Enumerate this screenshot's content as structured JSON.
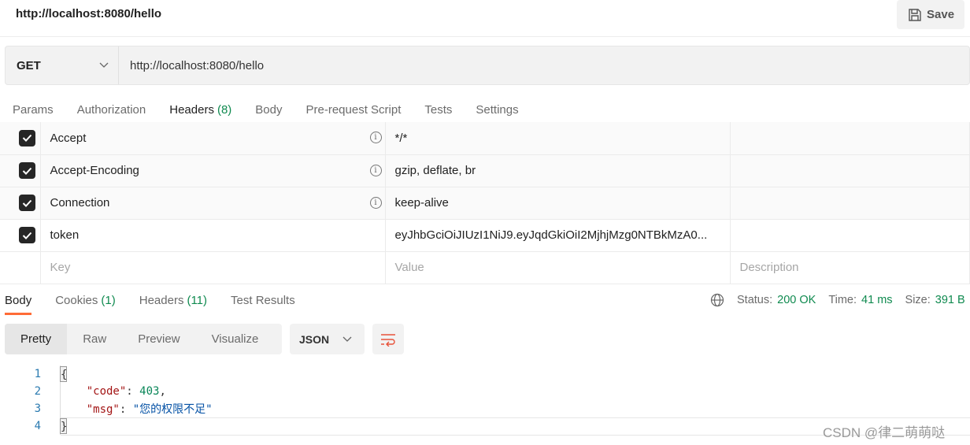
{
  "request": {
    "title": "http://localhost:8080/hello",
    "save_label": "Save",
    "method": "GET",
    "url": "http://localhost:8080/hello"
  },
  "req_tabs": [
    {
      "label": "Params"
    },
    {
      "label": "Authorization"
    },
    {
      "label": "Headers",
      "count": "(8)"
    },
    {
      "label": "Body"
    },
    {
      "label": "Pre-request Script"
    },
    {
      "label": "Tests"
    },
    {
      "label": "Settings"
    }
  ],
  "headers": [
    {
      "key": "Accept",
      "value": "*/*",
      "checked": true,
      "auto": true
    },
    {
      "key": "Accept-Encoding",
      "value": "gzip, deflate, br",
      "checked": true,
      "auto": true
    },
    {
      "key": "Connection",
      "value": "keep-alive",
      "checked": true,
      "auto": true
    },
    {
      "key": "token",
      "value": "eyJhbGciOiJIUzI1NiJ9.eyJqdGkiOiI2MjhjMzg0NTBkMzA0...",
      "checked": true,
      "auto": false
    }
  ],
  "placeholders": {
    "key": "Key",
    "value": "Value",
    "description": "Description"
  },
  "res_tabs": [
    {
      "label": "Body"
    },
    {
      "label": "Cookies",
      "count": "(1)"
    },
    {
      "label": "Headers",
      "count": "(11)"
    },
    {
      "label": "Test Results"
    }
  ],
  "status": {
    "status_label": "Status:",
    "status": "200 OK",
    "time_label": "Time:",
    "time": "41 ms",
    "size_label": "Size:",
    "size": "391 B"
  },
  "view_modes": [
    "Pretty",
    "Raw",
    "Preview",
    "Visualize"
  ],
  "format": "JSON",
  "code": {
    "open": "{",
    "code_key": "\"code\"",
    "code_val": "403",
    "msg_key": "\"msg\"",
    "msg_val": "\"您的权限不足\"",
    "close": "}",
    "line_numbers": [
      "1",
      "2",
      "3",
      "4"
    ]
  },
  "watermark": "CSDN @律二萌萌哒",
  "colors": {
    "accent": "#ff6c37",
    "success": "#0f8a4f"
  }
}
